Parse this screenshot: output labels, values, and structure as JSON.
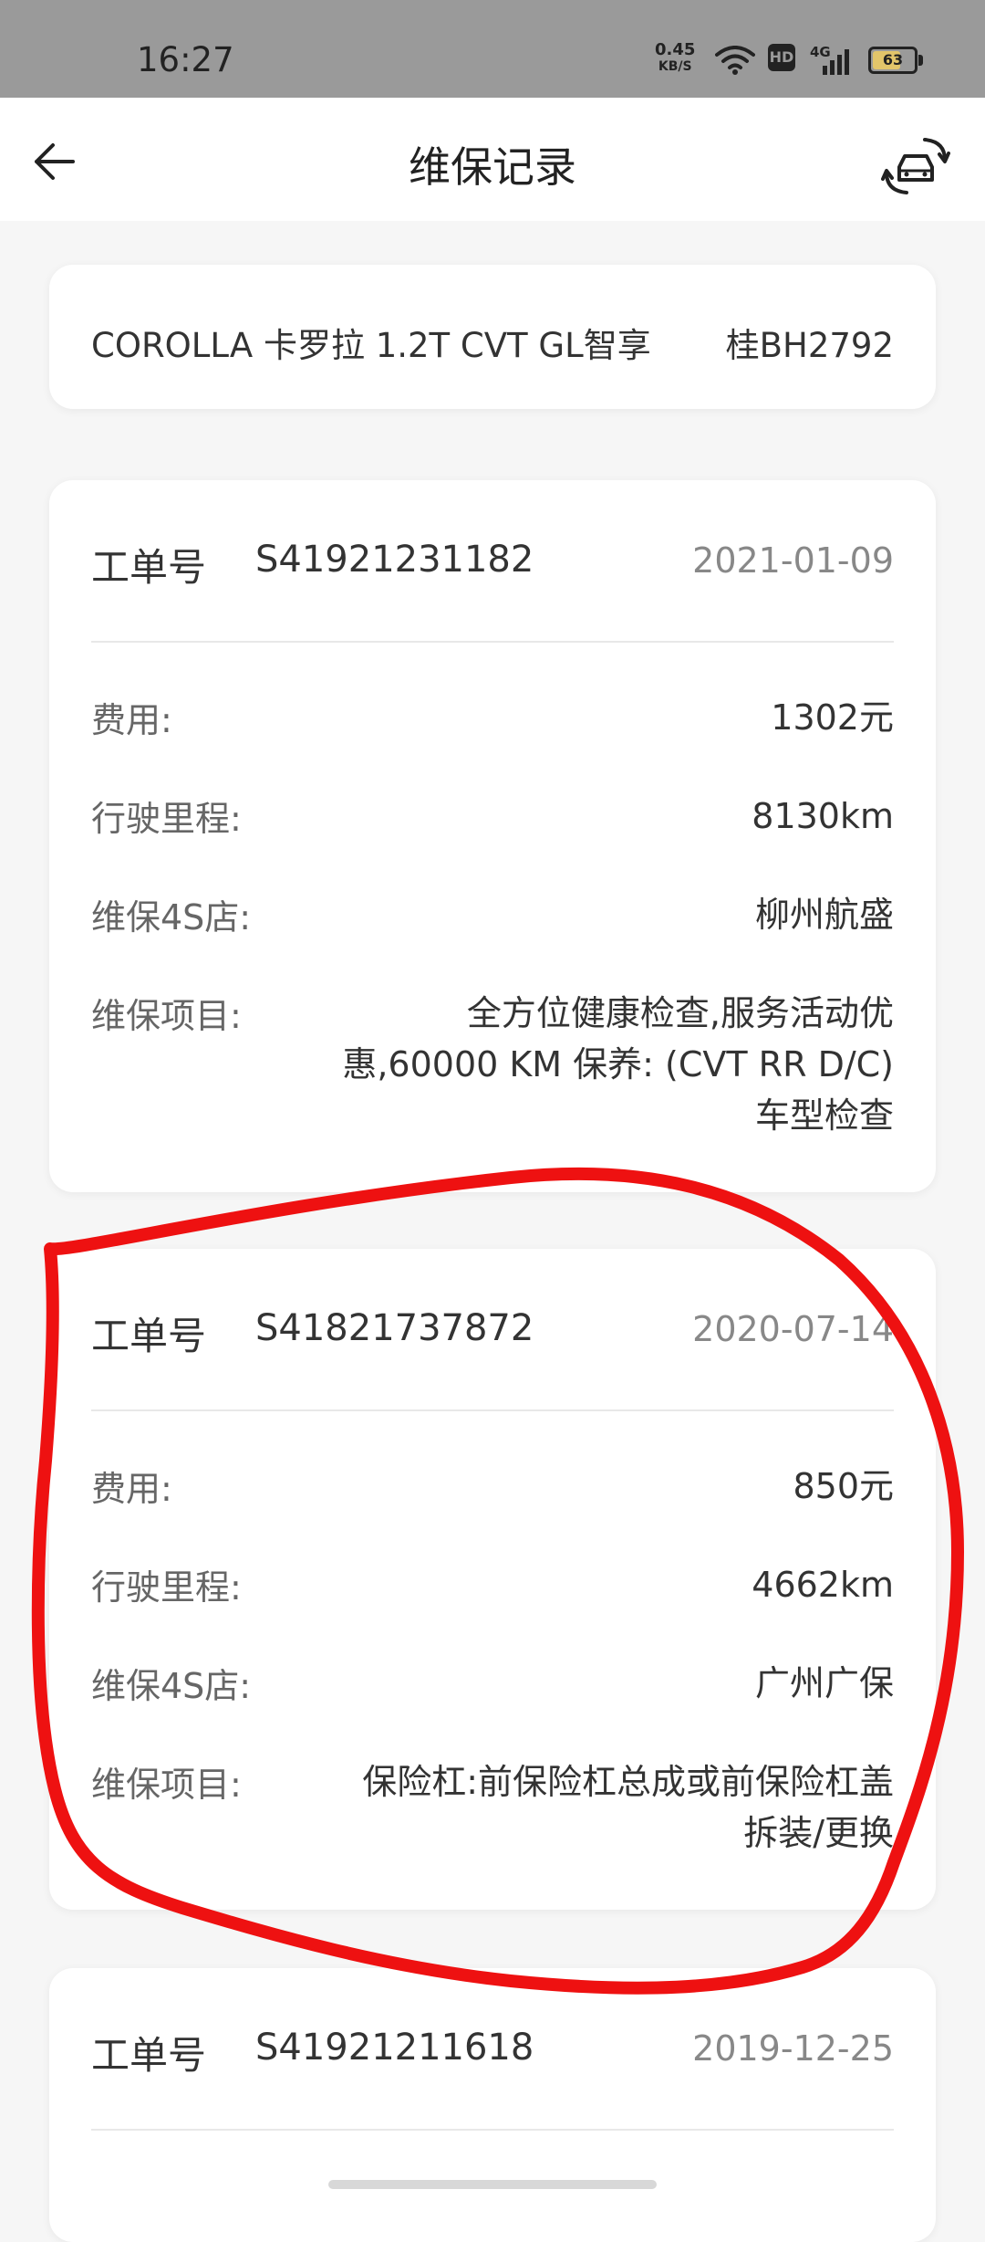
{
  "status_bar": {
    "time": "16:27",
    "net_speed": "0.45",
    "net_speed_unit": "KB/S",
    "hd_label": "HD",
    "network_type": "4G",
    "battery_level": "63"
  },
  "header": {
    "title": "维保记录",
    "back_icon": "arrow-left-icon",
    "switch_icon": "car-switch-icon"
  },
  "vehicle": {
    "model": "COROLLA 卡罗拉 1.2T CVT GL智享",
    "plate": "桂BH2792"
  },
  "labels": {
    "work_order": "工单号",
    "cost": "费用:",
    "mileage": "行驶里程:",
    "dealer": "维保4S店:",
    "items": "维保项目:"
  },
  "records": [
    {
      "work_order_no": "S41921231182",
      "date": "2021-01-09",
      "cost": "1302元",
      "mileage": "8130km",
      "dealer": "柳州航盛",
      "items": "全方位健康检查,服务活动优惠,60000 KM 保养: (CVT RR D/C) 车型检查"
    },
    {
      "work_order_no": "S41821737872",
      "date": "2020-07-14",
      "cost": "850元",
      "mileage": "4662km",
      "dealer": "广州广保",
      "items": "保险杠:前保险杠总成或前保险杠盖拆装/更换"
    },
    {
      "work_order_no": "S41921211618",
      "date": "2019-12-25"
    }
  ],
  "colors": {
    "annotation_red": "#ee1111",
    "card_bg": "#ffffff",
    "page_bg": "#f6f6f6"
  }
}
